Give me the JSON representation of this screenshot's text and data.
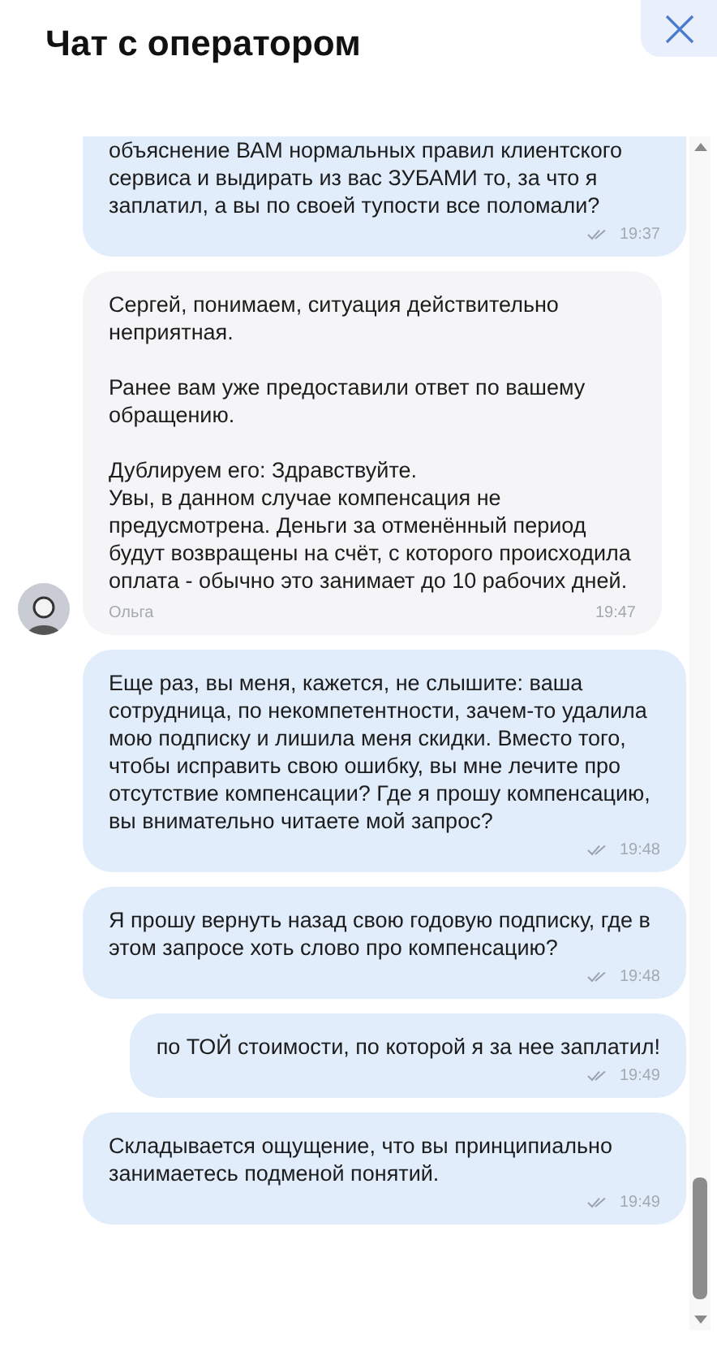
{
  "header": {
    "title": "Чат с оператором"
  },
  "messages": [
    {
      "kind": "outgoing",
      "text": "объяснение ВАМ нормальных правил клиентского сервиса и выдирать из вас ЗУБАМИ то, за что я заплатил, а вы по своей тупости все поломали?",
      "time": "19:37"
    },
    {
      "kind": "incoming",
      "text": "Сергей, понимаем, ситуация действительно неприятная.\n\nРанее вам уже предоставили ответ по вашему обращению.\n\nДублируем его: Здравствуйте.\nУвы, в данном случае компенсация не предусмотрена. Деньги за отменённый период будут возвращены на счёт, с которого происходила оплата - обычно это занимает до 10 рабочих дней.",
      "author": "Ольга",
      "time": "19:47"
    },
    {
      "kind": "outgoing",
      "text": "Еще раз, вы меня, кажется, не слышите: ваша сотрудница, по некомпетентности, зачем-то удалила мою подписку и лишила меня скидки. Вместо того, чтобы исправить свою ошибку, вы мне лечите про отсутствие компенсации? Где я прошу компенсацию, вы внимательно читаете мой запрос?",
      "time": "19:48"
    },
    {
      "kind": "outgoing",
      "text": "Я прошу вернуть назад свою годовую подписку, где в этом запросе хоть слово про компенсацию?",
      "time": "19:48"
    },
    {
      "kind": "outgoing",
      "text": "по ТОЙ стоимости, по которой я за нее заплатил!",
      "time": "19:49"
    },
    {
      "kind": "outgoing",
      "text": "Складывается ощущение, что вы принципиально занимаетесь подменой понятий.",
      "time": "19:49"
    }
  ]
}
